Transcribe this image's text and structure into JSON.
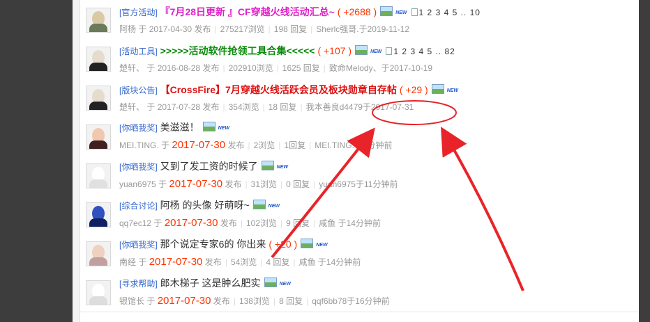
{
  "threads": [
    {
      "category": "[官方活动]",
      "title": "『7月28日更新 』CF穿越火线活动汇总~",
      "title_style": "pink",
      "count": "( +2688 )",
      "pages": "1 2 3 4 5 .. 10",
      "author": "阿杨",
      "date_prefix": "于",
      "date": "2017-04-30",
      "date_style": "plain",
      "posted": "发布",
      "views": "275217浏览",
      "replies": "198 回复",
      "last": "Sherlc强哥.于2019-11-12",
      "avatar": {
        "face": "#d9c9a4",
        "body": "#6a7a5a"
      }
    },
    {
      "category": "[活动工具]",
      "title": ">>>>>活动软件抢领工具合集<<<<<",
      "title_style": "green",
      "count": "( +107 )",
      "pages": "1 2 3 4 5 .. 82",
      "author": "楚轩、",
      "date_prefix": "于",
      "date": "2016-08-28",
      "date_style": "plain",
      "posted": "发布",
      "views": "202910浏览",
      "replies": "1625 回复",
      "last": "致命Melody、于2017-10-19",
      "avatar": {
        "face": "#e6dccd",
        "body": "#222222"
      }
    },
    {
      "category": "[版块公告]",
      "title": "【CrossFire】7月穿越火线活跃会员及板块勋章自存帖",
      "title_style": "red",
      "count": "( +29 )",
      "pages": "",
      "author": "楚轩、",
      "date_prefix": "于",
      "date": "2017-07-28",
      "date_style": "plain",
      "posted": "发布",
      "views": "354浏览",
      "replies": "18 回复",
      "last": "我本善良d4479于2017-07-31",
      "avatar": {
        "face": "#e6dccd",
        "body": "#222222"
      }
    },
    {
      "category": "[你晒我奖]",
      "title": "美滋滋！",
      "title_style": "plain",
      "count": "",
      "pages": "",
      "author": "MEI.TING.",
      "date_prefix": "于",
      "date": "2017-07-30",
      "date_style": "red",
      "posted": "发布",
      "views": "2浏览",
      "replies": "1回复",
      "last": "MEI.TING.于3分钟前",
      "avatar": {
        "face": "#f0c8b0",
        "body": "#402020"
      }
    },
    {
      "category": "[你晒我奖]",
      "title": "又到了发工资的时候了",
      "title_style": "plain",
      "count": "",
      "pages": "",
      "author": "yuan6975",
      "date_prefix": "于",
      "date": "2017-07-30",
      "date_style": "red",
      "posted": "发布",
      "views": "31浏览",
      "replies": "0 回复",
      "last": "yuan6975于11分钟前",
      "avatar": {
        "face": "#ffffff",
        "body": "#e0e0e0"
      }
    },
    {
      "category": "[综合讨论]",
      "title": "阿杨 的头像  好萌呀~",
      "title_style": "plain",
      "count": "",
      "pages": "",
      "author": "qq7ec12",
      "date_prefix": "于",
      "date": "2017-07-30",
      "date_style": "red",
      "posted": "发布",
      "views": "102浏览",
      "replies": "9 回复",
      "last": "咸鱼  于14分钟前",
      "avatar": {
        "face": "#3050c0",
        "body": "#102060"
      }
    },
    {
      "category": "[你晒我奖]",
      "title": "那个说定专家6的  你出来",
      "title_style": "plain",
      "count": "( +20 )",
      "pages": "",
      "author": "南经",
      "date_prefix": "于",
      "date": "2017-07-30",
      "date_style": "red",
      "posted": "发布",
      "views": "54浏览",
      "replies": "4 回复",
      "last": "咸鱼  于14分钟前",
      "avatar": {
        "face": "#f0d0c0",
        "body": "#c0a0a0"
      }
    },
    {
      "category": "[寻求帮助]",
      "title": "郎木梯子       这是肿么肥实",
      "title_style": "plain",
      "count": "",
      "pages": "",
      "author": "银馆长",
      "date_prefix": "于",
      "date": "2017-07-30",
      "date_style": "red",
      "posted": "发布",
      "views": "138浏览",
      "replies": "8 回复",
      "last": "qqf6bb78于16分钟前",
      "avatar": {
        "face": "#ffffff",
        "body": "#dddddd"
      }
    }
  ],
  "colors": {
    "annotation": "#e8242a",
    "count": "#ff3300",
    "category": "#3366cc"
  },
  "icons": {
    "image": "image-icon",
    "new": "NEW",
    "pages": "multipage-icon"
  }
}
